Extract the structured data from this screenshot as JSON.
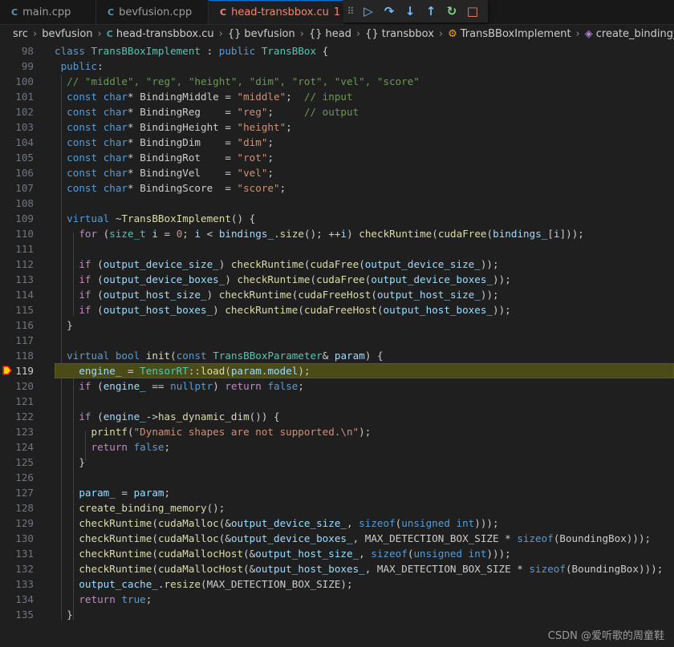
{
  "tabs": [
    {
      "label": "main.cpp",
      "icon": "C++",
      "active": false,
      "modified": ""
    },
    {
      "label": "bevfusion.cpp",
      "icon": "C++",
      "active": false,
      "modified": ""
    },
    {
      "label": "head-transbbox.cu",
      "icon": "C++",
      "active": true,
      "modified": "1"
    }
  ],
  "debug_toolbar": {
    "grip": "⠿",
    "continue": "▷",
    "step_over": "↷",
    "step_into": "↓",
    "step_out": "↑",
    "restart": "↻",
    "stop": "□"
  },
  "breadcrumbs": [
    "src",
    "bevfusion",
    "head-transbbox.cu",
    "bevfusion",
    "head",
    "transbbox",
    "TransBBoxImplement",
    "create_binding_memory()"
  ],
  "current_line": 119,
  "lines": [
    {
      "n": 98,
      "t": [
        [
          "k",
          "class"
        ],
        [
          "p",
          " "
        ],
        [
          "t",
          "TransBBoxImplement"
        ],
        [
          "p",
          " : "
        ],
        [
          "k",
          "public"
        ],
        [
          "p",
          " "
        ],
        [
          "t",
          "TransBBox"
        ],
        [
          "p",
          " {"
        ]
      ]
    },
    {
      "n": 99,
      "t": [
        [
          "p",
          " "
        ],
        [
          "k",
          "public"
        ],
        [
          "p",
          ":"
        ]
      ]
    },
    {
      "n": 100,
      "t": [
        [
          "p",
          "  "
        ],
        [
          "c",
          "// \"middle\", \"reg\", \"height\", \"dim\", \"rot\", \"vel\", \"score\""
        ]
      ]
    },
    {
      "n": 101,
      "t": [
        [
          "p",
          "  "
        ],
        [
          "k",
          "const"
        ],
        [
          "p",
          " "
        ],
        [
          "k",
          "char"
        ],
        [
          "p",
          "* BindingMiddle = "
        ],
        [
          "s",
          "\"middle\""
        ],
        [
          "p",
          ";  "
        ],
        [
          "c",
          "// input"
        ]
      ]
    },
    {
      "n": 102,
      "t": [
        [
          "p",
          "  "
        ],
        [
          "k",
          "const"
        ],
        [
          "p",
          " "
        ],
        [
          "k",
          "char"
        ],
        [
          "p",
          "* BindingReg    = "
        ],
        [
          "s",
          "\"reg\""
        ],
        [
          "p",
          ";     "
        ],
        [
          "c",
          "// output"
        ]
      ]
    },
    {
      "n": 103,
      "t": [
        [
          "p",
          "  "
        ],
        [
          "k",
          "const"
        ],
        [
          "p",
          " "
        ],
        [
          "k",
          "char"
        ],
        [
          "p",
          "* BindingHeight = "
        ],
        [
          "s",
          "\"height\""
        ],
        [
          "p",
          ";"
        ]
      ]
    },
    {
      "n": 104,
      "t": [
        [
          "p",
          "  "
        ],
        [
          "k",
          "const"
        ],
        [
          "p",
          " "
        ],
        [
          "k",
          "char"
        ],
        [
          "p",
          "* BindingDim    = "
        ],
        [
          "s",
          "\"dim\""
        ],
        [
          "p",
          ";"
        ]
      ]
    },
    {
      "n": 105,
      "t": [
        [
          "p",
          "  "
        ],
        [
          "k",
          "const"
        ],
        [
          "p",
          " "
        ],
        [
          "k",
          "char"
        ],
        [
          "p",
          "* BindingRot    = "
        ],
        [
          "s",
          "\"rot\""
        ],
        [
          "p",
          ";"
        ]
      ]
    },
    {
      "n": 106,
      "t": [
        [
          "p",
          "  "
        ],
        [
          "k",
          "const"
        ],
        [
          "p",
          " "
        ],
        [
          "k",
          "char"
        ],
        [
          "p",
          "* BindingVel    = "
        ],
        [
          "s",
          "\"vel\""
        ],
        [
          "p",
          ";"
        ]
      ]
    },
    {
      "n": 107,
      "t": [
        [
          "p",
          "  "
        ],
        [
          "k",
          "const"
        ],
        [
          "p",
          " "
        ],
        [
          "k",
          "char"
        ],
        [
          "p",
          "* BindingScore  = "
        ],
        [
          "s",
          "\"score\""
        ],
        [
          "p",
          ";"
        ]
      ]
    },
    {
      "n": 108,
      "t": []
    },
    {
      "n": 109,
      "t": [
        [
          "p",
          "  "
        ],
        [
          "k",
          "virtual"
        ],
        [
          "p",
          " ~"
        ],
        [
          "f",
          "TransBBoxImplement"
        ],
        [
          "p",
          "() {"
        ]
      ]
    },
    {
      "n": 110,
      "t": [
        [
          "p",
          "    "
        ],
        [
          "ctl",
          "for"
        ],
        [
          "p",
          " ("
        ],
        [
          "t",
          "size_t"
        ],
        [
          "p",
          " "
        ],
        [
          "v",
          "i"
        ],
        [
          "p",
          " = "
        ],
        [
          "s",
          "0"
        ],
        [
          "p",
          "; "
        ],
        [
          "v",
          "i"
        ],
        [
          "p",
          " < "
        ],
        [
          "v",
          "bindings_"
        ],
        [
          "p",
          "."
        ],
        [
          "f",
          "size"
        ],
        [
          "p",
          "(); ++"
        ],
        [
          "v",
          "i"
        ],
        [
          "p",
          ") "
        ],
        [
          "f",
          "checkRuntime"
        ],
        [
          "p",
          "("
        ],
        [
          "f",
          "cudaFree"
        ],
        [
          "p",
          "("
        ],
        [
          "v",
          "bindings_"
        ],
        [
          "p",
          "["
        ],
        [
          "v",
          "i"
        ],
        [
          "p",
          "]));"
        ]
      ]
    },
    {
      "n": 111,
      "t": []
    },
    {
      "n": 112,
      "t": [
        [
          "p",
          "    "
        ],
        [
          "ctl",
          "if"
        ],
        [
          "p",
          " ("
        ],
        [
          "v",
          "output_device_size_"
        ],
        [
          "p",
          ") "
        ],
        [
          "f",
          "checkRuntime"
        ],
        [
          "p",
          "("
        ],
        [
          "f",
          "cudaFree"
        ],
        [
          "p",
          "("
        ],
        [
          "v",
          "output_device_size_"
        ],
        [
          "p",
          "));"
        ]
      ]
    },
    {
      "n": 113,
      "t": [
        [
          "p",
          "    "
        ],
        [
          "ctl",
          "if"
        ],
        [
          "p",
          " ("
        ],
        [
          "v",
          "output_device_boxes_"
        ],
        [
          "p",
          ") "
        ],
        [
          "f",
          "checkRuntime"
        ],
        [
          "p",
          "("
        ],
        [
          "f",
          "cudaFree"
        ],
        [
          "p",
          "("
        ],
        [
          "v",
          "output_device_boxes_"
        ],
        [
          "p",
          "));"
        ]
      ]
    },
    {
      "n": 114,
      "t": [
        [
          "p",
          "    "
        ],
        [
          "ctl",
          "if"
        ],
        [
          "p",
          " ("
        ],
        [
          "v",
          "output_host_size_"
        ],
        [
          "p",
          ") "
        ],
        [
          "f",
          "checkRuntime"
        ],
        [
          "p",
          "("
        ],
        [
          "f",
          "cudaFreeHost"
        ],
        [
          "p",
          "("
        ],
        [
          "v",
          "output_host_size_"
        ],
        [
          "p",
          "));"
        ]
      ]
    },
    {
      "n": 115,
      "t": [
        [
          "p",
          "    "
        ],
        [
          "ctl",
          "if"
        ],
        [
          "p",
          " ("
        ],
        [
          "v",
          "output_host_boxes_"
        ],
        [
          "p",
          ") "
        ],
        [
          "f",
          "checkRuntime"
        ],
        [
          "p",
          "("
        ],
        [
          "f",
          "cudaFreeHost"
        ],
        [
          "p",
          "("
        ],
        [
          "v",
          "output_host_boxes_"
        ],
        [
          "p",
          "));"
        ]
      ]
    },
    {
      "n": 116,
      "t": [
        [
          "p",
          "  }"
        ]
      ]
    },
    {
      "n": 117,
      "t": []
    },
    {
      "n": 118,
      "t": [
        [
          "p",
          "  "
        ],
        [
          "k",
          "virtual"
        ],
        [
          "p",
          " "
        ],
        [
          "k",
          "bool"
        ],
        [
          "p",
          " "
        ],
        [
          "f",
          "init"
        ],
        [
          "p",
          "("
        ],
        [
          "k",
          "const"
        ],
        [
          "p",
          " "
        ],
        [
          "t",
          "TransBBoxParameter"
        ],
        [
          "p",
          "& "
        ],
        [
          "v",
          "param"
        ],
        [
          "p",
          ") {"
        ]
      ]
    },
    {
      "n": 119,
      "t": [
        [
          "p",
          "    "
        ],
        [
          "v",
          "engine_"
        ],
        [
          "p",
          " = "
        ],
        [
          "t",
          "TensorRT"
        ],
        [
          "p",
          "::"
        ],
        [
          "f",
          "load"
        ],
        [
          "p",
          "("
        ],
        [
          "v",
          "param"
        ],
        [
          "p",
          "."
        ],
        [
          "v",
          "model"
        ],
        [
          "p",
          ");"
        ]
      ]
    },
    {
      "n": 120,
      "t": [
        [
          "p",
          "    "
        ],
        [
          "ctl",
          "if"
        ],
        [
          "p",
          " ("
        ],
        [
          "v",
          "engine_"
        ],
        [
          "p",
          " == "
        ],
        [
          "k",
          "nullptr"
        ],
        [
          "p",
          ") "
        ],
        [
          "ctl",
          "return"
        ],
        [
          "p",
          " "
        ],
        [
          "k",
          "false"
        ],
        [
          "p",
          ";"
        ]
      ]
    },
    {
      "n": 121,
      "t": []
    },
    {
      "n": 122,
      "t": [
        [
          "p",
          "    "
        ],
        [
          "ctl",
          "if"
        ],
        [
          "p",
          " ("
        ],
        [
          "v",
          "engine_"
        ],
        [
          "p",
          "->"
        ],
        [
          "f",
          "has_dynamic_dim"
        ],
        [
          "p",
          "()) {"
        ]
      ]
    },
    {
      "n": 123,
      "t": [
        [
          "p",
          "      "
        ],
        [
          "f",
          "printf"
        ],
        [
          "p",
          "("
        ],
        [
          "s",
          "\"Dynamic shapes are not supported.\\n\""
        ],
        [
          "p",
          ");"
        ]
      ]
    },
    {
      "n": 124,
      "t": [
        [
          "p",
          "      "
        ],
        [
          "ctl",
          "return"
        ],
        [
          "p",
          " "
        ],
        [
          "k",
          "false"
        ],
        [
          "p",
          ";"
        ]
      ]
    },
    {
      "n": 125,
      "t": [
        [
          "p",
          "    }"
        ]
      ]
    },
    {
      "n": 126,
      "t": []
    },
    {
      "n": 127,
      "t": [
        [
          "p",
          "    "
        ],
        [
          "v",
          "param_"
        ],
        [
          "p",
          " = "
        ],
        [
          "v",
          "param"
        ],
        [
          "p",
          ";"
        ]
      ]
    },
    {
      "n": 128,
      "t": [
        [
          "p",
          "    "
        ],
        [
          "f",
          "create_binding_memory"
        ],
        [
          "p",
          "();"
        ]
      ]
    },
    {
      "n": 129,
      "t": [
        [
          "p",
          "    "
        ],
        [
          "f",
          "checkRuntime"
        ],
        [
          "p",
          "("
        ],
        [
          "f",
          "cudaMalloc"
        ],
        [
          "p",
          "(&"
        ],
        [
          "v",
          "output_device_size_"
        ],
        [
          "p",
          ", "
        ],
        [
          "k",
          "sizeof"
        ],
        [
          "p",
          "("
        ],
        [
          "k",
          "unsigned int"
        ],
        [
          "p",
          ")));"
        ]
      ]
    },
    {
      "n": 130,
      "t": [
        [
          "p",
          "    "
        ],
        [
          "f",
          "checkRuntime"
        ],
        [
          "p",
          "("
        ],
        [
          "f",
          "cudaMalloc"
        ],
        [
          "p",
          "(&"
        ],
        [
          "v",
          "output_device_boxes_"
        ],
        [
          "p",
          ", MAX_DETECTION_BOX_SIZE * "
        ],
        [
          "k",
          "sizeof"
        ],
        [
          "p",
          "(BoundingBox)));"
        ]
      ]
    },
    {
      "n": 131,
      "t": [
        [
          "p",
          "    "
        ],
        [
          "f",
          "checkRuntime"
        ],
        [
          "p",
          "("
        ],
        [
          "f",
          "cudaMallocHost"
        ],
        [
          "p",
          "(&"
        ],
        [
          "v",
          "output_host_size_"
        ],
        [
          "p",
          ", "
        ],
        [
          "k",
          "sizeof"
        ],
        [
          "p",
          "("
        ],
        [
          "k",
          "unsigned int"
        ],
        [
          "p",
          ")));"
        ]
      ]
    },
    {
      "n": 132,
      "t": [
        [
          "p",
          "    "
        ],
        [
          "f",
          "checkRuntime"
        ],
        [
          "p",
          "("
        ],
        [
          "f",
          "cudaMallocHost"
        ],
        [
          "p",
          "(&"
        ],
        [
          "v",
          "output_host_boxes_"
        ],
        [
          "p",
          ", MAX_DETECTION_BOX_SIZE * "
        ],
        [
          "k",
          "sizeof"
        ],
        [
          "p",
          "(BoundingBox)));"
        ]
      ]
    },
    {
      "n": 133,
      "t": [
        [
          "p",
          "    "
        ],
        [
          "v",
          "output_cache_"
        ],
        [
          "p",
          "."
        ],
        [
          "f",
          "resize"
        ],
        [
          "p",
          "(MAX_DETECTION_BOX_SIZE);"
        ]
      ]
    },
    {
      "n": 134,
      "t": [
        [
          "p",
          "    "
        ],
        [
          "ctl",
          "return"
        ],
        [
          "p",
          " "
        ],
        [
          "k",
          "true"
        ],
        [
          "p",
          ";"
        ]
      ]
    },
    {
      "n": 135,
      "t": [
        [
          "p",
          "  }"
        ]
      ]
    }
  ],
  "watermark": "CSDN @爱听歌的周童鞋",
  "colors": {
    "accent": "#0078d4",
    "breakpoint": "#e51400",
    "current_line": "#4b4b18",
    "tab_modified": "#f48771"
  }
}
